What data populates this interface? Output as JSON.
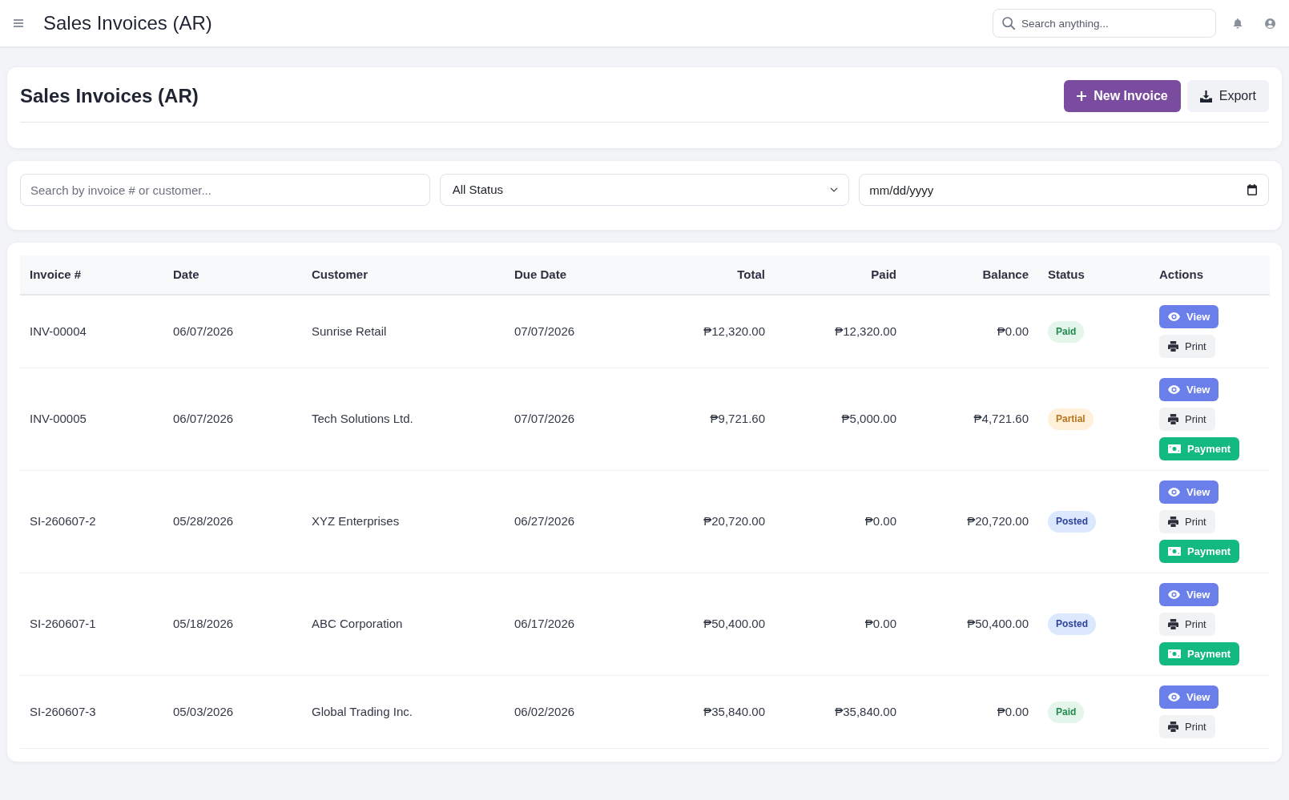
{
  "topbar": {
    "title": "Sales Invoices (AR)",
    "search": {
      "placeholder": "Search anything..."
    }
  },
  "page_header": {
    "title": "Sales Invoices (AR)",
    "buttons": [
      {
        "label": "New Invoice",
        "kind": "new"
      },
      {
        "label": "Export",
        "kind": "export"
      }
    ]
  },
  "filters": {
    "search": {
      "placeholder": "Search by invoice # or customer..."
    },
    "status": {
      "value": "All Status"
    },
    "date": {
      "placeholder": "mm/dd/yyyy"
    }
  },
  "table": {
    "columns": [
      "Invoice #",
      "Date",
      "Customer",
      "Due Date",
      "Total",
      "Paid",
      "Balance",
      "Status",
      "Actions"
    ],
    "rows": [
      {
        "invoice": "INV-00004",
        "date": "06/07/2026",
        "customer": "Sunrise Retail",
        "due_date": "07/07/2026",
        "total": "₱12,320.00",
        "paid": "₱12,320.00",
        "balance": "₱0.00",
        "status": {
          "label": "Paid",
          "kind": "paid"
        },
        "actions": [
          {
            "label": "View",
            "kind": "view"
          },
          {
            "label": "Print",
            "kind": "print"
          }
        ]
      },
      {
        "invoice": "INV-00005",
        "date": "06/07/2026",
        "customer": "Tech Solutions Ltd.",
        "due_date": "07/07/2026",
        "total": "₱9,721.60",
        "paid": "₱5,000.00",
        "balance": "₱4,721.60",
        "status": {
          "label": "Partial",
          "kind": "partial"
        },
        "actions": [
          {
            "label": "View",
            "kind": "view"
          },
          {
            "label": "Print",
            "kind": "print"
          },
          {
            "label": "Payment",
            "kind": "payment"
          }
        ]
      },
      {
        "invoice": "SI-260607-2",
        "date": "05/28/2026",
        "customer": "XYZ Enterprises",
        "due_date": "06/27/2026",
        "total": "₱20,720.00",
        "paid": "₱0.00",
        "balance": "₱20,720.00",
        "status": {
          "label": "Posted",
          "kind": "posted"
        },
        "actions": [
          {
            "label": "View",
            "kind": "view"
          },
          {
            "label": "Print",
            "kind": "print"
          },
          {
            "label": "Payment",
            "kind": "payment"
          }
        ]
      },
      {
        "invoice": "SI-260607-1",
        "date": "05/18/2026",
        "customer": "ABC Corporation",
        "due_date": "06/17/2026",
        "total": "₱50,400.00",
        "paid": "₱0.00",
        "balance": "₱50,400.00",
        "status": {
          "label": "Posted",
          "kind": "posted"
        },
        "actions": [
          {
            "label": "View",
            "kind": "view"
          },
          {
            "label": "Print",
            "kind": "print"
          },
          {
            "label": "Payment",
            "kind": "payment"
          }
        ]
      },
      {
        "invoice": "SI-260607-3",
        "date": "05/03/2026",
        "customer": "Global Trading Inc.",
        "due_date": "06/02/2026",
        "total": "₱35,840.00",
        "paid": "₱35,840.00",
        "balance": "₱0.00",
        "status": {
          "label": "Paid",
          "kind": "paid"
        },
        "actions": [
          {
            "label": "View",
            "kind": "view"
          },
          {
            "label": "Print",
            "kind": "print"
          }
        ]
      }
    ]
  }
}
